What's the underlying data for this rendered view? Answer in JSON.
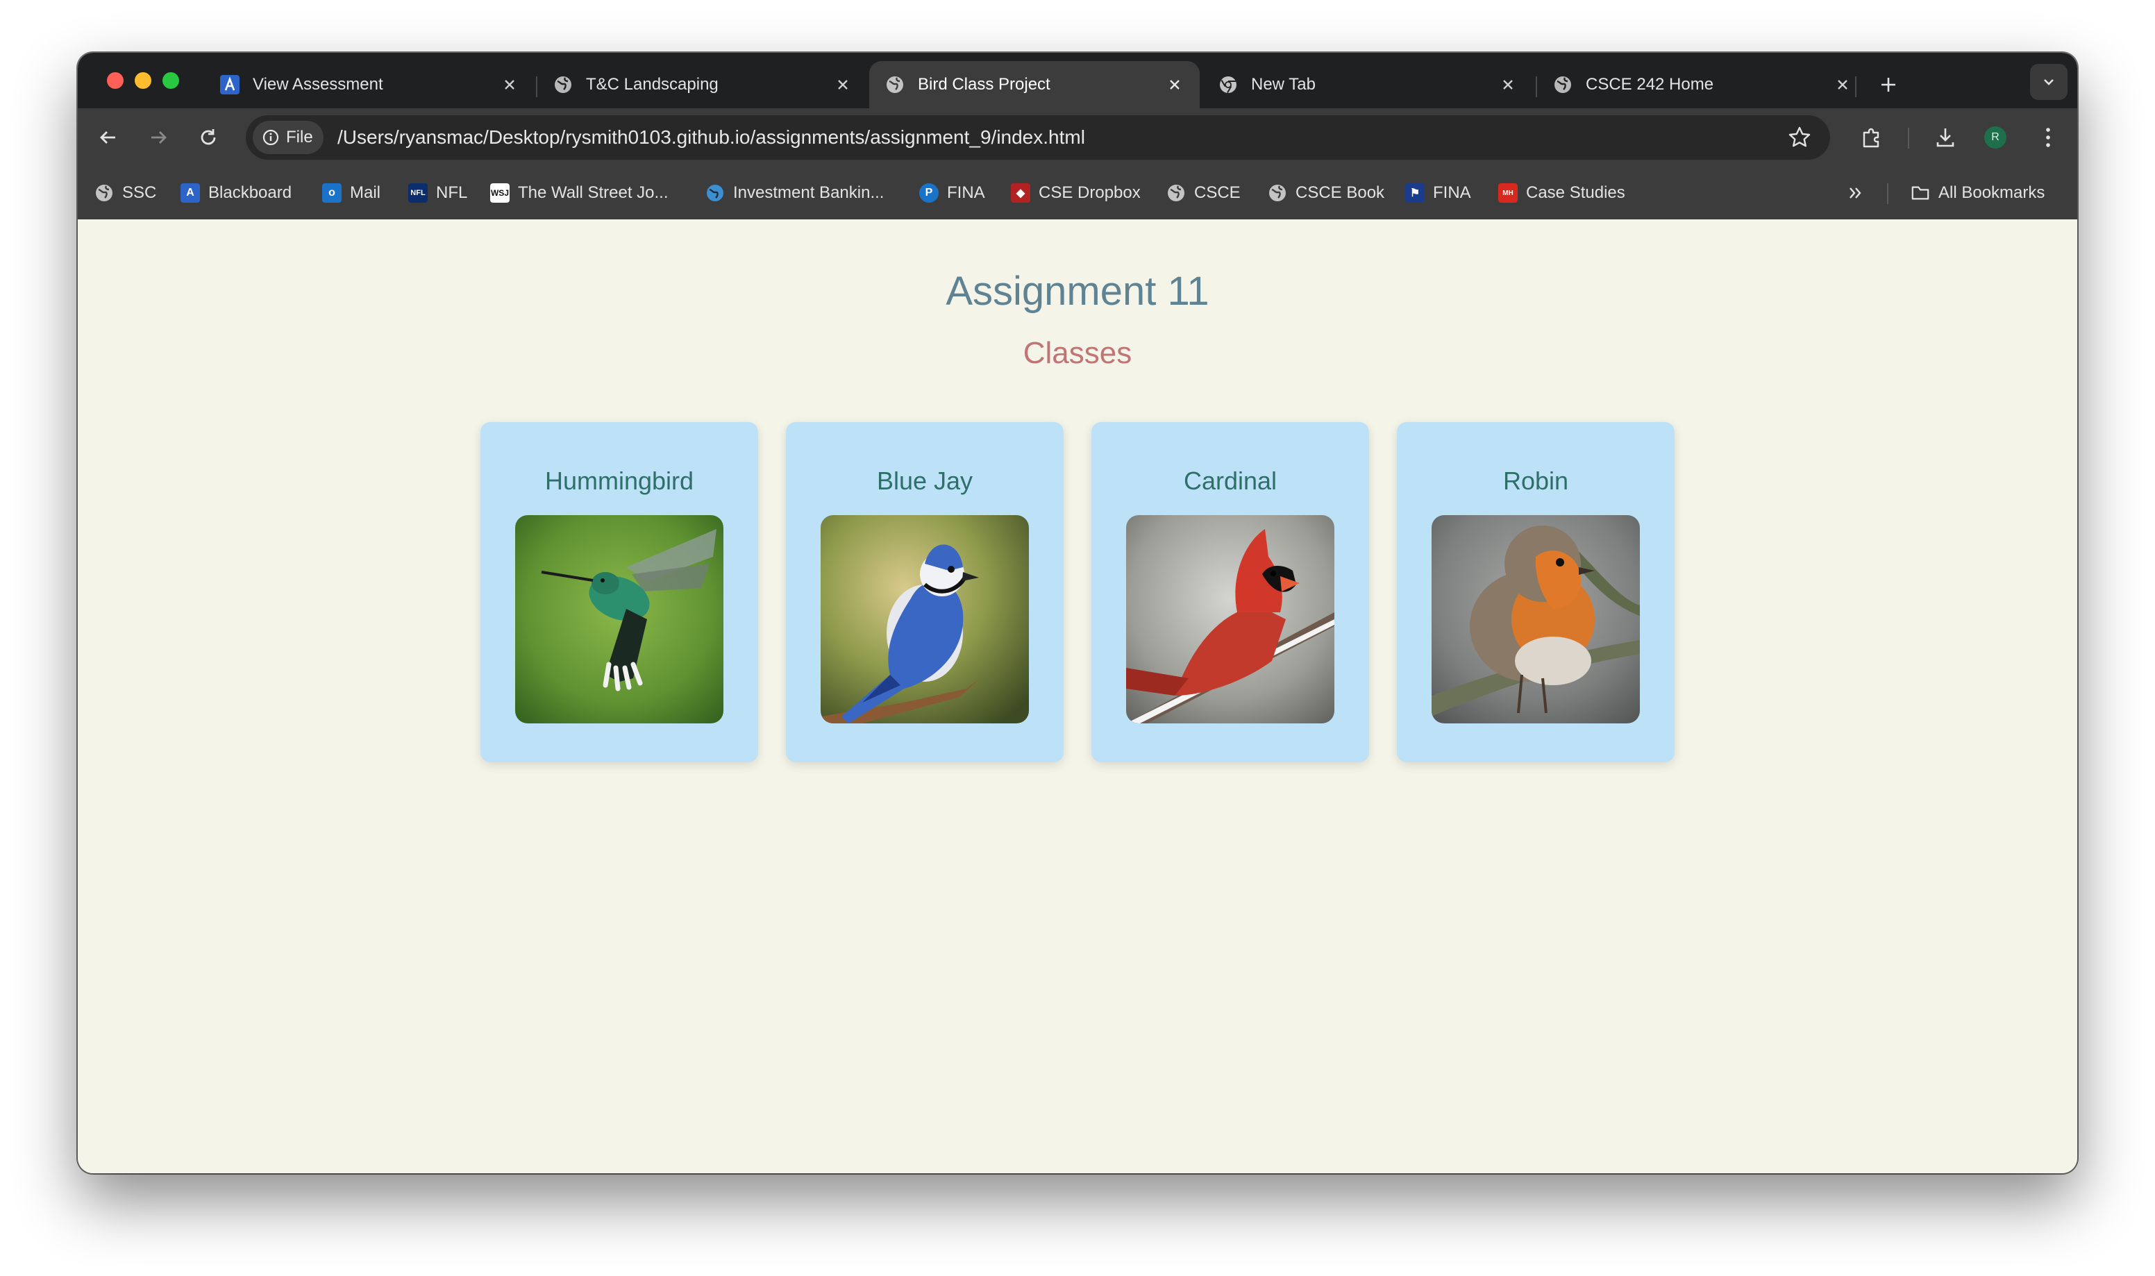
{
  "browser": {
    "tabs": [
      {
        "title": "View Assessment",
        "icon": "assessment-a-icon"
      },
      {
        "title": "T&C Landscaping",
        "icon": "globe-icon"
      },
      {
        "title": "Bird Class Project",
        "icon": "globe-icon",
        "active": true
      },
      {
        "title": "New Tab",
        "icon": "chrome-icon"
      },
      {
        "title": "CSCE 242 Home",
        "icon": "globe-icon"
      }
    ],
    "address": {
      "chip_label": "File",
      "url": "/Users/ryansmac/Desktop/rysmith0103.github.io/assignments/assignment_9/index.html"
    },
    "profile_initial": "R",
    "bookmarks": [
      {
        "label": "SSC",
        "icon": "globe-icon"
      },
      {
        "label": "Blackboard",
        "icon": "blackboard-icon"
      },
      {
        "label": "Mail",
        "icon": "outlook-icon"
      },
      {
        "label": "NFL",
        "icon": "nfl-icon"
      },
      {
        "label": "The Wall Street Jo...",
        "icon": "wsj-icon"
      },
      {
        "label": "Investment Bankin...",
        "icon": "globe-icon"
      },
      {
        "label": "FINA",
        "icon": "p-icon"
      },
      {
        "label": "CSE Dropbox",
        "icon": "dropbox-icon"
      },
      {
        "label": "CSCE",
        "icon": "globe-icon"
      },
      {
        "label": "CSCE Book",
        "icon": "globe-icon"
      },
      {
        "label": "FINA",
        "icon": "flag-icon"
      },
      {
        "label": "Case Studies",
        "icon": "mcgraw-hill-icon"
      }
    ],
    "all_bookmarks_label": "All Bookmarks"
  },
  "page": {
    "title": "Assignment 11",
    "subtitle": "Classes",
    "cards": [
      {
        "name": "Hummingbird"
      },
      {
        "name": "Blue Jay"
      },
      {
        "name": "Cardinal"
      },
      {
        "name": "Robin"
      }
    ]
  },
  "colors": {
    "page_bg": "#f4f4e9",
    "title": "#5f8393",
    "subtitle": "#c07474",
    "card_bg": "#bde2f8",
    "card_title": "#2e6f6a"
  }
}
